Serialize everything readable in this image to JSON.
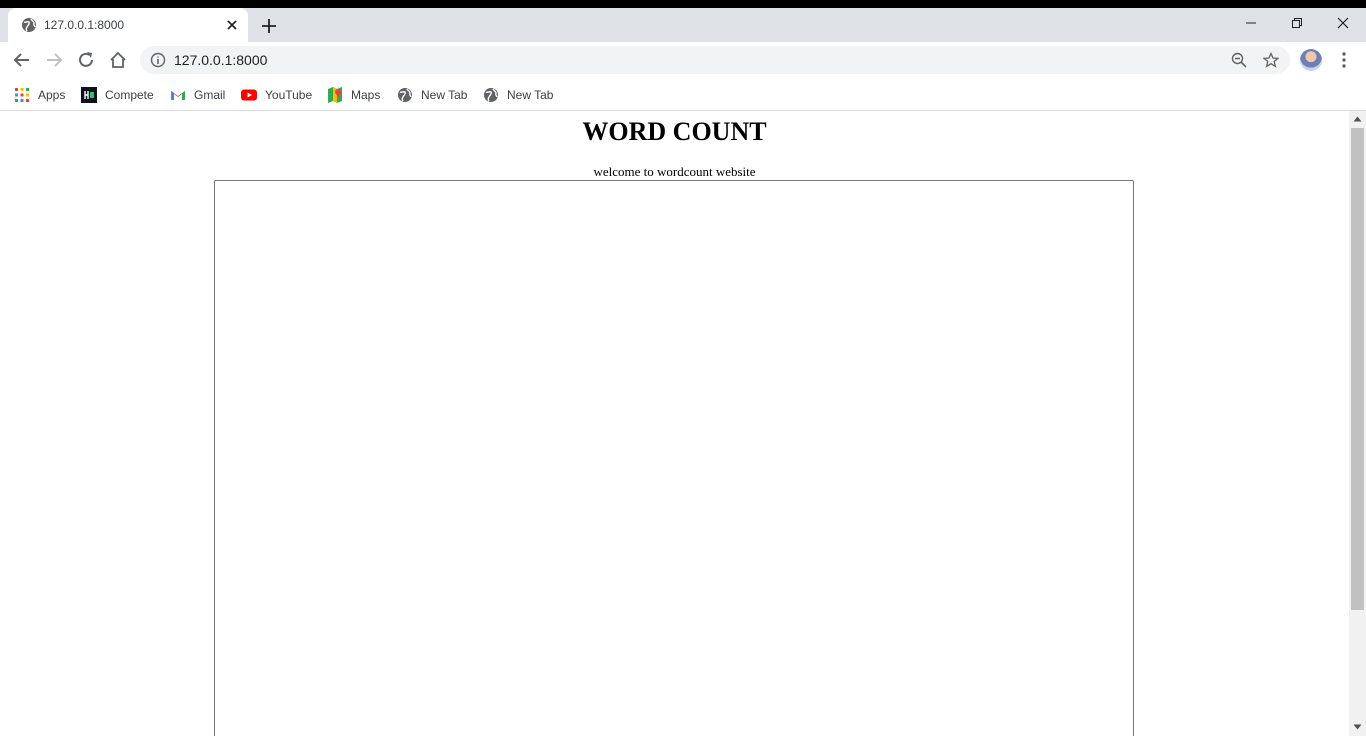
{
  "browser": {
    "tab": {
      "title": "127.0.0.1:8000"
    },
    "address_bar": {
      "url": "127.0.0.1:8000"
    },
    "bookmarks": [
      {
        "label": "Apps",
        "icon": "apps-grid-icon"
      },
      {
        "label": "Compete",
        "icon": "hackerrank-icon"
      },
      {
        "label": "Gmail",
        "icon": "gmail-icon"
      },
      {
        "label": "YouTube",
        "icon": "youtube-icon"
      },
      {
        "label": "Maps",
        "icon": "maps-icon"
      },
      {
        "label": "New Tab",
        "icon": "globe-icon"
      },
      {
        "label": "New Tab",
        "icon": "globe-icon"
      }
    ]
  },
  "page": {
    "title": "WORD COUNT",
    "subtitle": "welcome to wordcount website",
    "textarea_value": ""
  },
  "colors": {
    "tab_strip": "#dee1e6",
    "omnibox": "#f1f3f4",
    "text": "#000000"
  }
}
